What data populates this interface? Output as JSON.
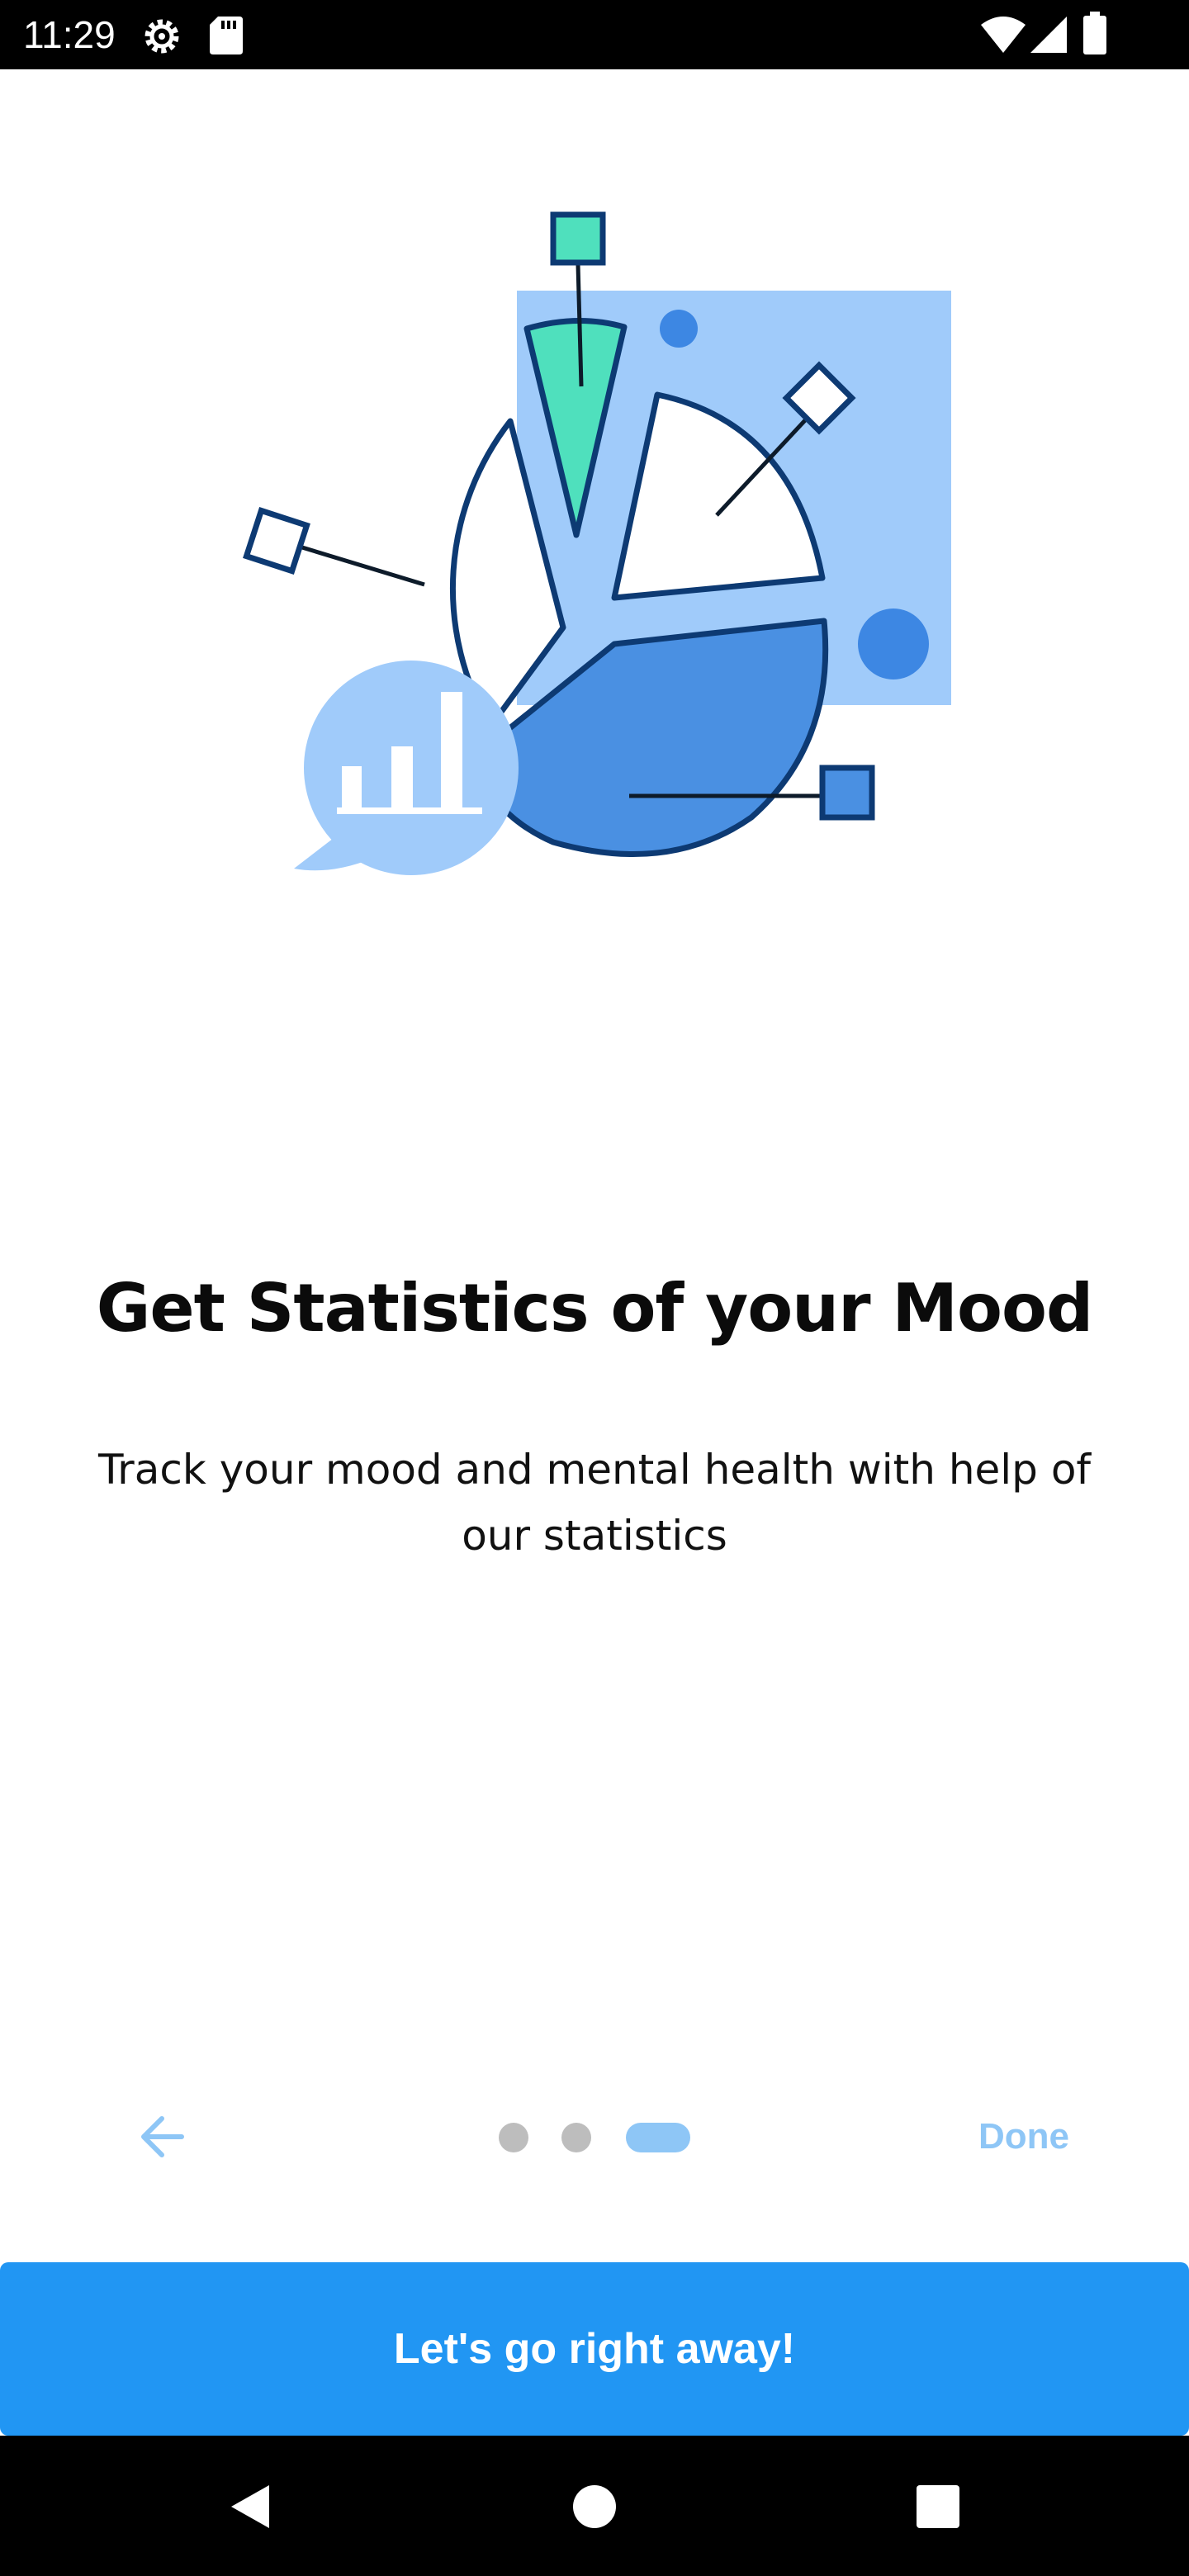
{
  "status_bar": {
    "time": "11:29",
    "icons": [
      "settings-gear-icon",
      "sd-card-icon",
      "wifi-icon",
      "cell-signal-icon",
      "battery-icon"
    ]
  },
  "illustration": {
    "icon": "pie-chart-statistics-illustration",
    "colors": {
      "light_blue": "#a0cbfa",
      "mid_blue": "#4a90e2",
      "dot_blue": "#3d87e3",
      "teal": "#4fe0bd",
      "navy_outline": "#0d3a73"
    }
  },
  "onboarding": {
    "title": "Get Statistics of your Mood",
    "subtitle": "Track your mood and mental health with help of our statistics"
  },
  "navigation": {
    "back_icon": "arrow-left-icon",
    "page_count": 3,
    "current_page": 3,
    "done_label": "Done"
  },
  "cta": {
    "label": "Let's go right away!"
  },
  "system_nav": {
    "icons": [
      "back-triangle-icon",
      "home-circle-icon",
      "recents-square-icon"
    ]
  },
  "colors": {
    "accent": "#2196f3",
    "accent_light": "#8ec6f6",
    "inactive_dot": "#bdbdbd",
    "text_dark": "#0b0b0b"
  }
}
